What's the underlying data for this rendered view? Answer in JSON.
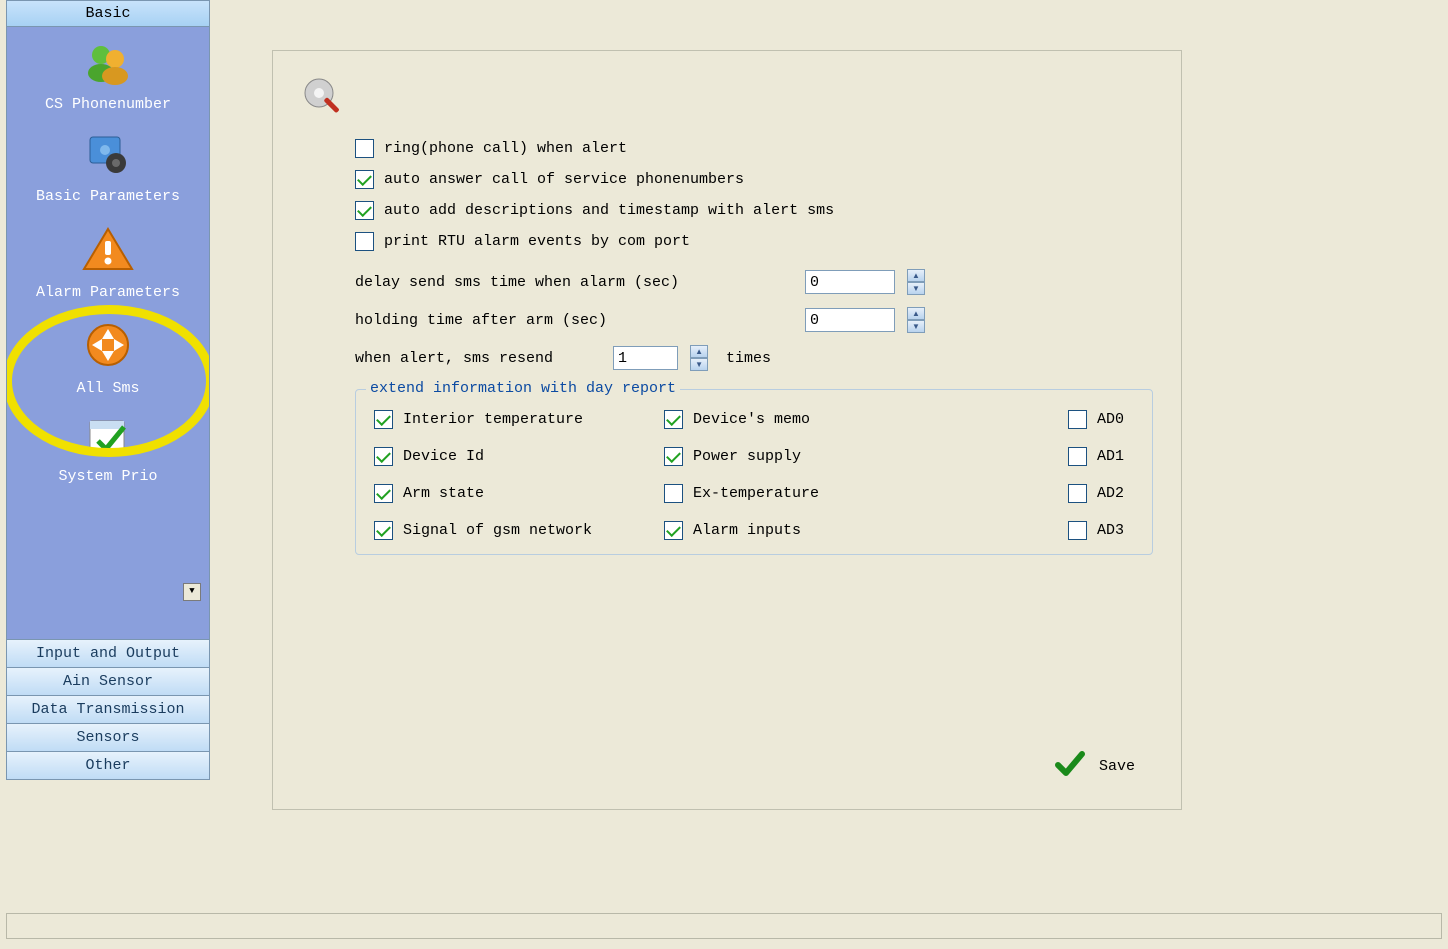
{
  "sidebar": {
    "header": "Basic",
    "items": [
      {
        "label": "CS Phonenumber",
        "icon": "users-icon"
      },
      {
        "label": "Basic Parameters",
        "icon": "gear-photo-icon"
      },
      {
        "label": "Alarm Parameters",
        "icon": "warning-triangle-icon",
        "highlighted": true
      },
      {
        "label": "All Sms",
        "icon": "arrows-circle-icon"
      },
      {
        "label": "System Prio",
        "icon": "calendar-check-icon"
      }
    ],
    "tabs": [
      "Input and Output",
      "Ain Sensor",
      "Data Transmission",
      "Sensors",
      "Other"
    ]
  },
  "form": {
    "checkboxes": [
      {
        "label": "ring(phone call) when alert",
        "checked": false
      },
      {
        "label": "auto answer call of service phonenumbers",
        "checked": true
      },
      {
        "label": "auto add descriptions and timestamp with alert sms",
        "checked": true
      },
      {
        "label": "print RTU alarm events by com port",
        "checked": false
      }
    ],
    "delay_label": "delay send sms time when alarm (sec)",
    "delay_value": "0",
    "holding_label": "holding time after arm (sec)",
    "holding_value": "0",
    "resend_prefix": "when alert, sms resend",
    "resend_value": "1",
    "resend_suffix": "times"
  },
  "group": {
    "title": "extend information with day report",
    "options": [
      {
        "label": "Interior temperature",
        "checked": true
      },
      {
        "label": "Device's memo",
        "checked": true
      },
      {
        "label": "AD0",
        "checked": false
      },
      {
        "label": "Device Id",
        "checked": true
      },
      {
        "label": "Power supply",
        "checked": true
      },
      {
        "label": "AD1",
        "checked": false
      },
      {
        "label": "Arm state",
        "checked": true
      },
      {
        "label": "Ex-temperature",
        "checked": false
      },
      {
        "label": "AD2",
        "checked": false
      },
      {
        "label": "Signal of gsm network",
        "checked": true
      },
      {
        "label": "Alarm inputs",
        "checked": true
      },
      {
        "label": "AD3",
        "checked": false
      }
    ]
  },
  "save_label": "Save"
}
